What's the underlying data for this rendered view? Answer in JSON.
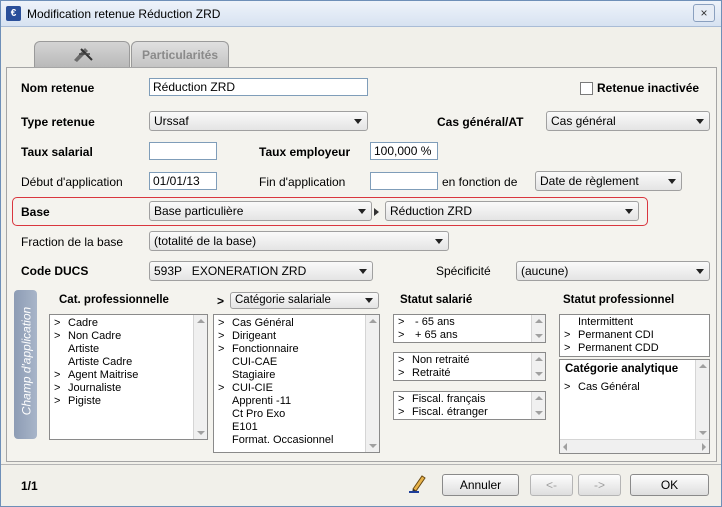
{
  "window": {
    "title": "Modification retenue Réduction ZRD",
    "icon": "app-logo-icon",
    "close": "×"
  },
  "tabs": [
    {
      "label": "",
      "icon": "ruler-compass-icon"
    },
    {
      "label": "Particularités"
    }
  ],
  "form": {
    "nom_retenue": {
      "label": "Nom retenue",
      "value": "Réduction ZRD"
    },
    "retenue_inactivee": {
      "label": "Retenue inactivée",
      "checked": false
    },
    "type_retenue": {
      "label": "Type retenue",
      "value": "Urssaf"
    },
    "cas_general": {
      "label": "Cas général/AT",
      "value": "Cas général"
    },
    "taux_salarial": {
      "label": "Taux salarial",
      "value": ""
    },
    "taux_employeur": {
      "label": "Taux employeur",
      "value": "100,000 %"
    },
    "debut_application": {
      "label": "Début d'application",
      "value": "01/01/13"
    },
    "fin_application": {
      "label": "Fin d'application",
      "value": ""
    },
    "en_fonction_de": {
      "label": "en fonction de",
      "value": "Date de règlement"
    },
    "base": {
      "label": "Base",
      "value": "Base particulière",
      "sub_value": "Réduction ZRD"
    },
    "fraction_base": {
      "label": "Fraction de la base",
      "value": "(totalité de la base)"
    },
    "code_ducs": {
      "label": "Code DUCS",
      "value": "593P   EXONERATION ZRD"
    },
    "specificite": {
      "label": "Spécificité",
      "value": "(aucune)"
    }
  },
  "champ": {
    "label": "Champ d'application",
    "cat_pro": {
      "header": "Cat. professionnelle",
      "items": [
        {
          "mark": ">",
          "text": "Cadre"
        },
        {
          "mark": ">",
          "text": "Non Cadre"
        },
        {
          "mark": "",
          "text": "Artiste"
        },
        {
          "mark": "",
          "text": "Artiste Cadre"
        },
        {
          "mark": ">",
          "text": "Agent Maitrise"
        },
        {
          "mark": ">",
          "text": "Journaliste"
        },
        {
          "mark": ">",
          "text": "Pigiste"
        }
      ]
    },
    "cat_salariale": {
      "prefix": ">",
      "select": "Catégorie salariale",
      "items": [
        {
          "mark": ">",
          "text": "Cas Général"
        },
        {
          "mark": ">",
          "text": "Dirigeant"
        },
        {
          "mark": ">",
          "text": "Fonctionnaire"
        },
        {
          "mark": "",
          "text": "CUI-CAE"
        },
        {
          "mark": "",
          "text": "Stagiaire"
        },
        {
          "mark": ">",
          "text": "CUI-CIE"
        },
        {
          "mark": "",
          "text": "Apprenti -11"
        },
        {
          "mark": "",
          "text": "Ct Pro Exo"
        },
        {
          "mark": "",
          "text": "E101"
        },
        {
          "mark": "",
          "text": "Format. Occasionnel"
        }
      ]
    },
    "statut_salarie": {
      "header": "Statut salarié",
      "age": [
        {
          "mark": ">",
          "text": " - 65 ans"
        },
        {
          "mark": ">",
          "text": " + 65 ans"
        }
      ],
      "retraite": [
        {
          "mark": ">",
          "text": "Non retraité"
        },
        {
          "mark": ">",
          "text": "Retraité"
        }
      ],
      "fiscal": [
        {
          "mark": ">",
          "text": "Fiscal. français"
        },
        {
          "mark": ">",
          "text": "Fiscal. étranger"
        }
      ]
    },
    "statut_pro": {
      "header": "Statut professionnel",
      "items": [
        {
          "mark": "",
          "text": "Intermittent"
        },
        {
          "mark": ">",
          "text": "Permanent CDI"
        },
        {
          "mark": ">",
          "text": "Permanent CDD"
        }
      ]
    },
    "cat_analytique": {
      "header": "Catégorie analytique",
      "items": [
        {
          "mark": ">",
          "text": "Cas Général"
        }
      ]
    }
  },
  "footer": {
    "pager": "1/1",
    "edit_icon": "pencil-icon",
    "annuler": "Annuler",
    "prev": "<-",
    "next": "->",
    "ok": "OK"
  }
}
